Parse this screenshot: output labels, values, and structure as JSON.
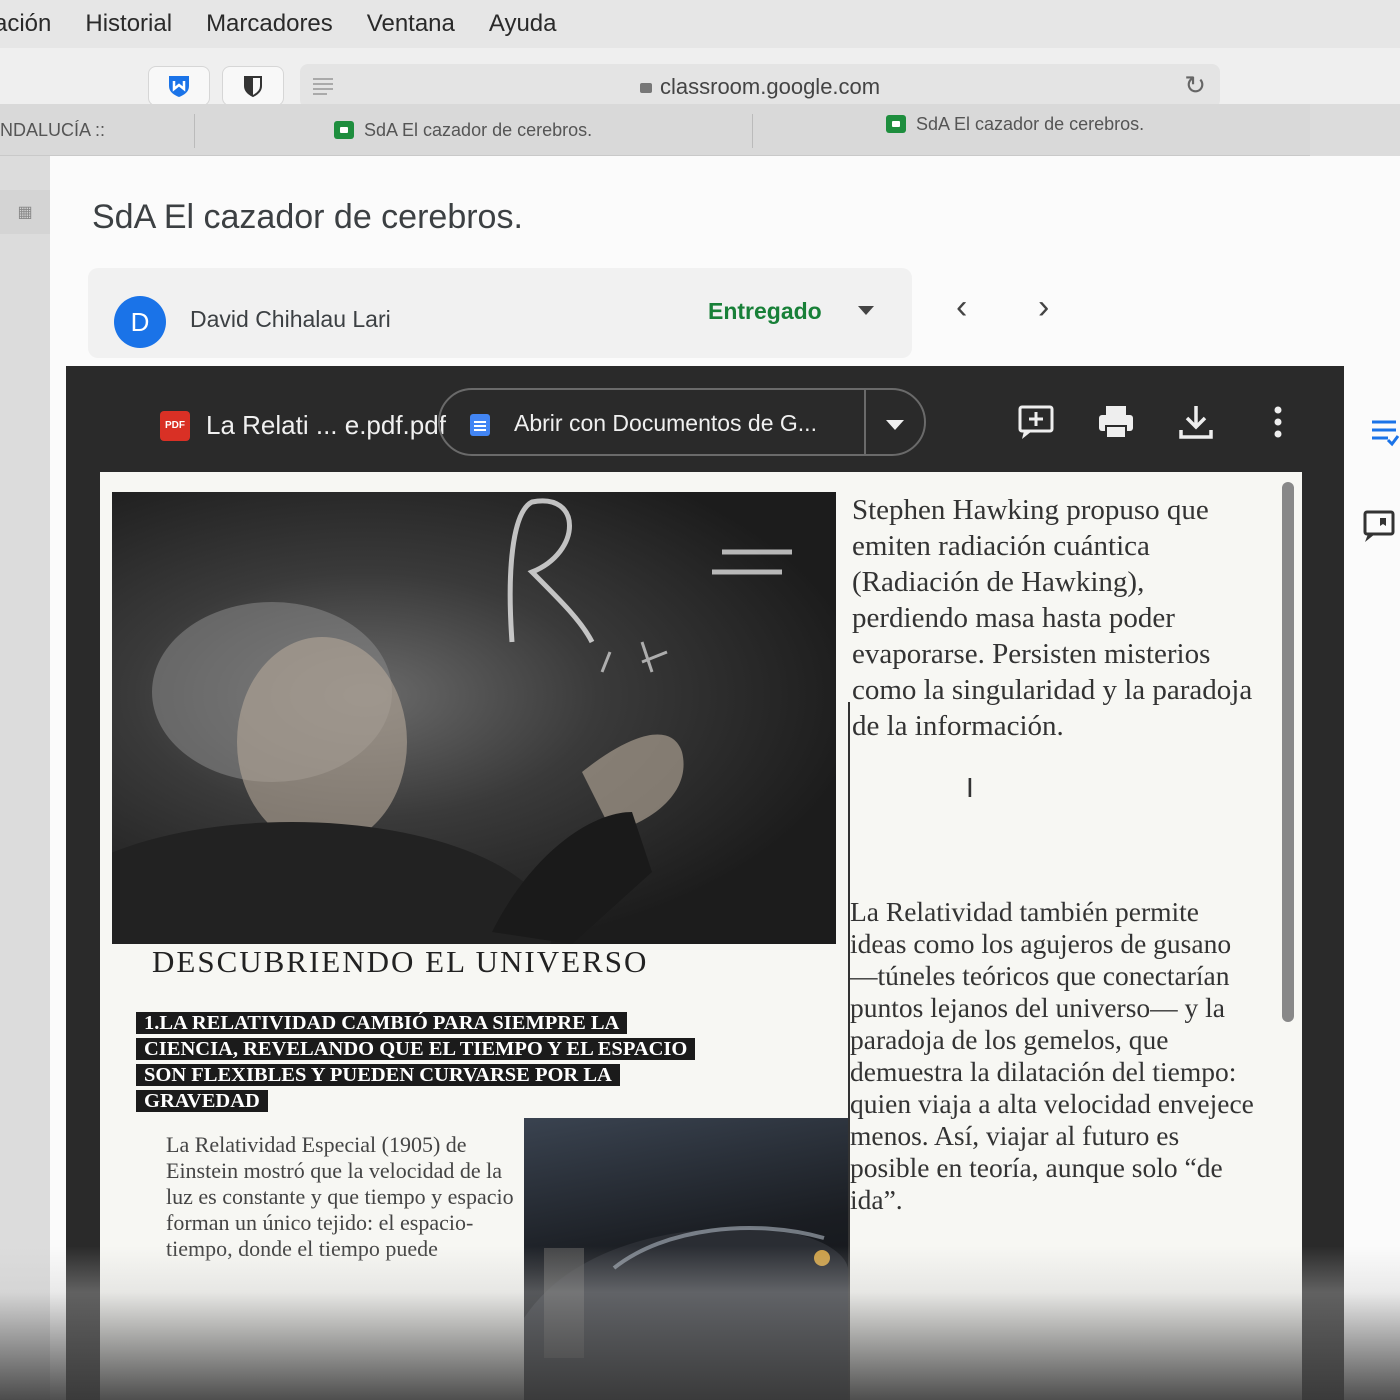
{
  "menu": [
    "ación",
    "Historial",
    "Marcadores",
    "Ventana",
    "Ayuda"
  ],
  "browser": {
    "url": "classroom.google.com",
    "tabs": [
      {
        "label": "NDALUCÍA ::"
      },
      {
        "label": "SdA El cazador de cerebros."
      },
      {
        "label": "SdA El cazador de cerebros."
      }
    ]
  },
  "assignment": {
    "title": "SdA El cazador de cerebros.",
    "student_initial": "D",
    "student_name": "David Chihalau Lari",
    "status": "Entregado"
  },
  "viewer": {
    "file_name": "La Relati ... e.pdf.pdf",
    "pdf_badge": "PDF",
    "open_with": "Abrir con Documentos de G..."
  },
  "document": {
    "right_para1": "Stephen Hawking propuso que emiten radiación cuántica (Radiación de Hawking), perdiendo masa hasta poder evaporarse. Persisten misterios como la singularidad y la paradoja de la información.",
    "right_para2": "La Relatividad también permite ideas como los agujeros de gusano —túneles teóricos que conectarían puntos lejanos del universo— y la paradoja de los gemelos, que demuestra la dilatación del tiempo: quien viaja a alta velocidad envejece menos. Así, viajar al futuro es posible en teoría, aunque solo “de ida”.",
    "heading": "DESCUBRIENDO EL UNIVERSO",
    "subheading": "1.LA RELATIVIDAD CAMBIÓ PARA SIEMPRE LA CIENCIA, REVELANDO QUE EL TIEMPO Y EL ESPACIO SON FLEXIBLES Y PUEDEN CURVARSE POR LA GRAVEDAD",
    "left_para": "La Relatividad Especial (1905) de Einstein mostró que la velocidad de la luz es constante y que tiempo y espacio forman un único tejido: el espacio-tiempo, donde el tiempo puede"
  }
}
